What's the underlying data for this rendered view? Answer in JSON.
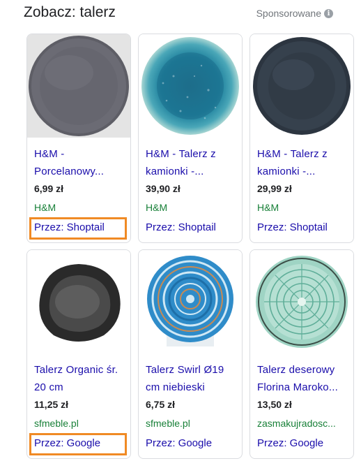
{
  "header": {
    "title": "Zobacz: talerz",
    "sponsored_label": "Sponsorowane",
    "info_icon": "i"
  },
  "products": [
    {
      "name_lines": [
        "H&M -",
        "Porcelanowy..."
      ],
      "price": "6,99 zł",
      "merchant": "H&M",
      "via": "Przez: Shoptail",
      "image": "plate-gray-icon",
      "highlighted": true
    },
    {
      "name_lines": [
        "H&M - Talerz z",
        "kamionki -..."
      ],
      "price": "39,90 zł",
      "merchant": "H&M",
      "via": "Przez: Shoptail",
      "image": "plate-blue-speckled-icon",
      "highlighted": false
    },
    {
      "name_lines": [
        "H&M - Talerz z",
        "kamionki -..."
      ],
      "price": "29,99 zł",
      "merchant": "H&M",
      "via": "Przez: Shoptail",
      "image": "plate-dark-navy-icon",
      "highlighted": false
    },
    {
      "name_lines": [
        "Talerz Organic śr.",
        "20 cm"
      ],
      "price": "11,25 zł",
      "merchant": "sfmeble.pl",
      "via": "Przez: Google",
      "image": "plate-black-organic-icon",
      "highlighted": true
    },
    {
      "name_lines": [
        "Talerz Swirl Ø19",
        "cm niebieski"
      ],
      "price": "6,75 zł",
      "merchant": "sfmeble.pl",
      "via": "Przez: Google",
      "image": "plate-blue-swirl-icon",
      "highlighted": false
    },
    {
      "name_lines": [
        "Talerz deserowy",
        "Florina Maroko..."
      ],
      "price": "13,50 zł",
      "merchant": "zasmakujradosc...",
      "via": "Przez: Google",
      "image": "plate-mint-pattern-icon",
      "highlighted": false
    }
  ],
  "colors": {
    "link": "#1a0dab",
    "merchant": "#188038",
    "highlight": "#f08a24"
  }
}
